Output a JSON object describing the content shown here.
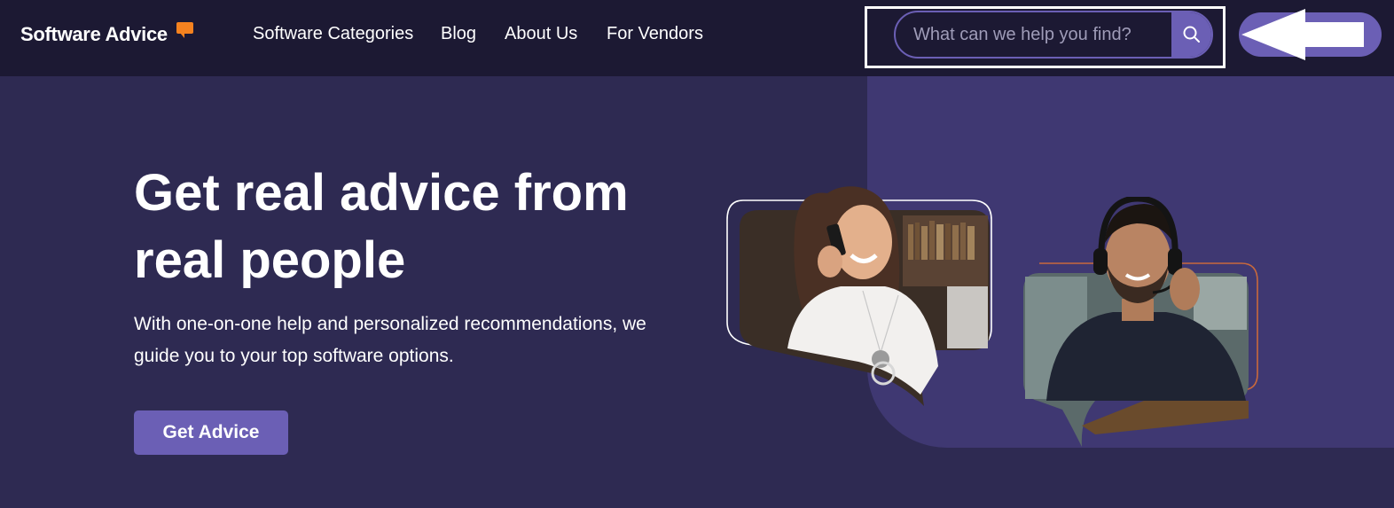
{
  "header": {
    "logo_text": "Software Advice",
    "nav": [
      {
        "label": "Software Categories"
      },
      {
        "label": "Blog"
      },
      {
        "label": "About Us"
      },
      {
        "label": "For Vendors"
      }
    ],
    "search": {
      "placeholder": "What can we help you find?"
    }
  },
  "hero": {
    "title": "Get real advice from real people",
    "subtitle": "With one-on-one help and personalized recommendations, we guide you to your top software options.",
    "cta_label": "Get Advice"
  },
  "colors": {
    "nav_bg": "#1c1933",
    "hero_bg": "#2e2a52",
    "panel_bg": "#3f3872",
    "accent": "#6b5fb5",
    "logo_accent": "#f5821f"
  },
  "icons": [
    "logo-bubble-icon",
    "search-icon",
    "arrow-left-icon"
  ]
}
